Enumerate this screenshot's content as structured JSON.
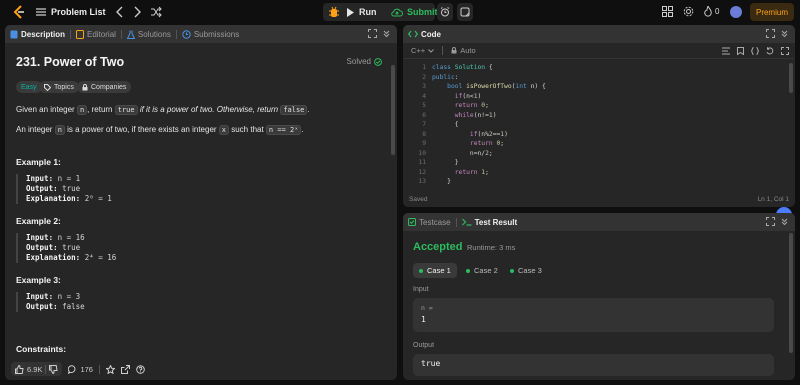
{
  "topbar": {
    "problem_list": "Problem List",
    "run": "Run",
    "submit": "Submit",
    "streak": "0",
    "premium": "Premium"
  },
  "desc": {
    "tabs": [
      "Description",
      "Editorial",
      "Solutions",
      "Submissions"
    ],
    "title": "231. Power of Two",
    "solved": "Solved",
    "pills": {
      "difficulty": "Easy",
      "topics": "Topics",
      "companies": "Companies"
    },
    "p1": {
      "a": "Given an integer ",
      "n": "n",
      "b": ", return ",
      "true": "true",
      "c": " if it is a power of two. Otherwise, return ",
      "false": "false",
      "d": "."
    },
    "p2": {
      "a": "An integer ",
      "n": "n",
      "b": " is a power of two, if there exists an integer ",
      "x": "x",
      "c": " such that ",
      "expr": "n == 2ˣ",
      "d": "."
    },
    "examples": [
      {
        "title": "Example 1:",
        "input": "n = 1",
        "output": "true",
        "explanation": "2⁰ = 1"
      },
      {
        "title": "Example 2:",
        "input": "n = 16",
        "output": "true",
        "explanation": "2⁴ = 16"
      },
      {
        "title": "Example 3:",
        "input": "n = 3",
        "output": "false"
      }
    ],
    "labels": {
      "input": "Input:",
      "output": "Output:",
      "explanation": "Explanation:"
    },
    "constraints": "Constraints:",
    "likes": "6.9K",
    "comments": "176"
  },
  "code": {
    "tab": "Code",
    "language": "C++",
    "auto": "Auto",
    "saved": "Saved",
    "cursor": "Ln 1, Col 1",
    "line_numbers": [
      "1",
      "2",
      "3",
      "4",
      "5",
      "6",
      "7",
      "8",
      "9",
      "10",
      "11",
      "12",
      "13"
    ]
  },
  "test": {
    "tabs": [
      "Testcase",
      "Test Result"
    ],
    "status": "Accepted",
    "runtime": "Runtime: 3 ms",
    "cases": [
      "Case 1",
      "Case 2",
      "Case 3"
    ],
    "input_label": "Input",
    "input_var": "n =",
    "input_value": "1",
    "output_label": "Output",
    "output_value": "true"
  },
  "colors": {
    "accepted": "#2cbb5d",
    "easy": "#00b8a3",
    "premium": "#ffa116",
    "panel": "#262626"
  }
}
